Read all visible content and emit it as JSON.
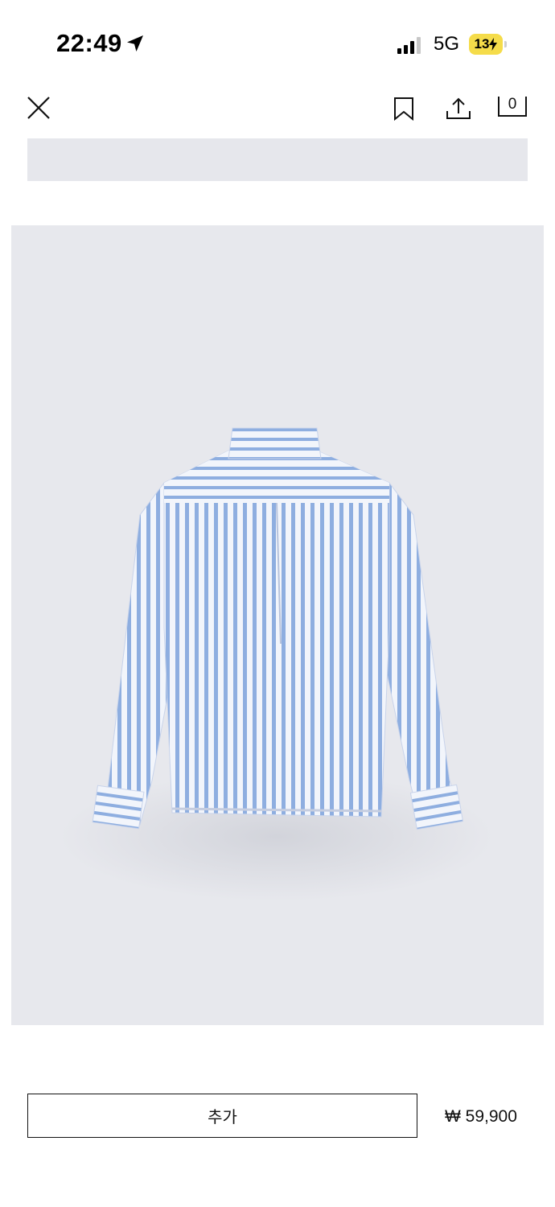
{
  "status_bar": {
    "time": "22:49",
    "network": "5G",
    "battery": "13"
  },
  "nav": {
    "cart_count": "0"
  },
  "product": {
    "image": "striped-shirt-back-view",
    "colors": {
      "background": "#e7e8ed",
      "stripe": "#8eaee0",
      "fabric": "#f2f5fb"
    }
  },
  "footer": {
    "add_label": "추가",
    "price": "₩ 59,900"
  }
}
